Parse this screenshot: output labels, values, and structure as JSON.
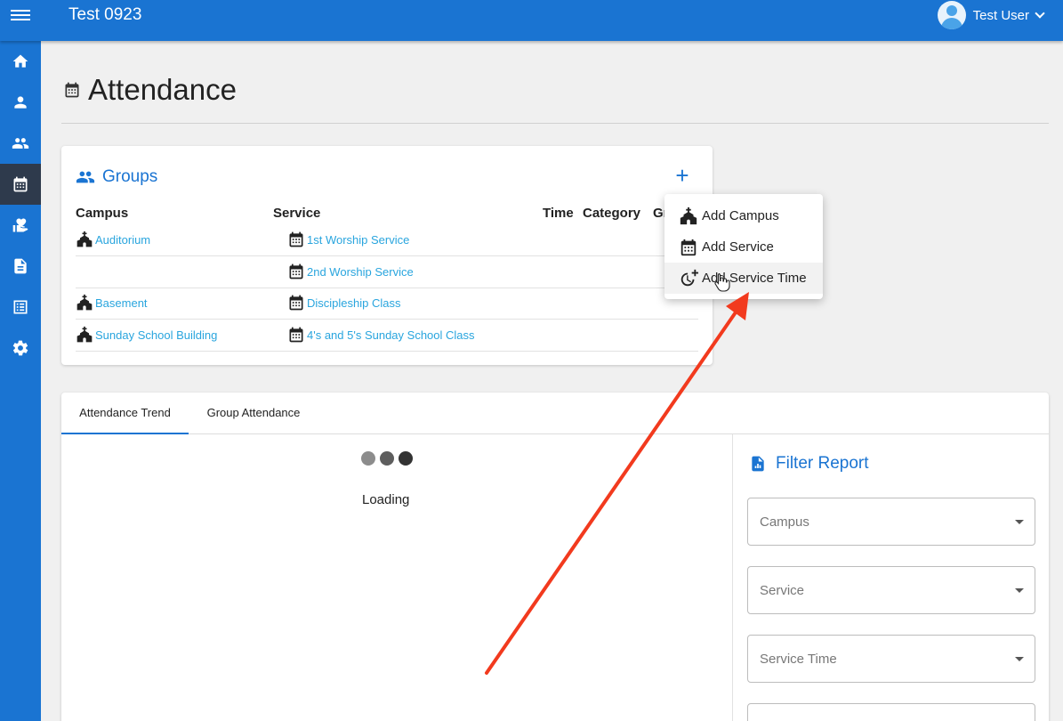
{
  "header": {
    "app_title": "Test 0923",
    "user_name": "Test User"
  },
  "sidebar": {
    "items": [
      {
        "icon": "home-icon"
      },
      {
        "icon": "person-icon"
      },
      {
        "icon": "people-icon"
      },
      {
        "icon": "calendar-icon",
        "active": true
      },
      {
        "icon": "donation-icon"
      },
      {
        "icon": "document-icon"
      },
      {
        "icon": "list-icon"
      },
      {
        "icon": "settings-icon"
      }
    ]
  },
  "page": {
    "title": "Attendance"
  },
  "groups_card": {
    "title": "Groups",
    "add_label": "+",
    "columns": [
      "Campus",
      "Service",
      "Time",
      "Category",
      "Gr"
    ],
    "rows": [
      {
        "campus": "Auditorium",
        "service": "1st Worship Service"
      },
      {
        "campus": "",
        "service": "2nd Worship Service"
      },
      {
        "campus": "Basement",
        "service": "Discipleship Class"
      },
      {
        "campus": "Sunday School Building",
        "service": "4's and 5's Sunday School Class"
      }
    ]
  },
  "add_menu": {
    "items": [
      "Add Campus",
      "Add Service",
      "Add Service Time"
    ],
    "hovered": "Add Service Time"
  },
  "report": {
    "tabs": [
      "Attendance Trend",
      "Group Attendance"
    ],
    "active_tab": "Attendance Trend",
    "loading_text": "Loading",
    "filter": {
      "title": "Filter Report",
      "fields": [
        {
          "placeholder": "Campus"
        },
        {
          "placeholder": "Service"
        },
        {
          "placeholder": "Service Time"
        }
      ]
    }
  },
  "colors": {
    "primary": "#1a74d2",
    "link": "#29a5de",
    "sidebar_active": "#2e3a4c",
    "annotation_arrow": "#f23a1e"
  }
}
